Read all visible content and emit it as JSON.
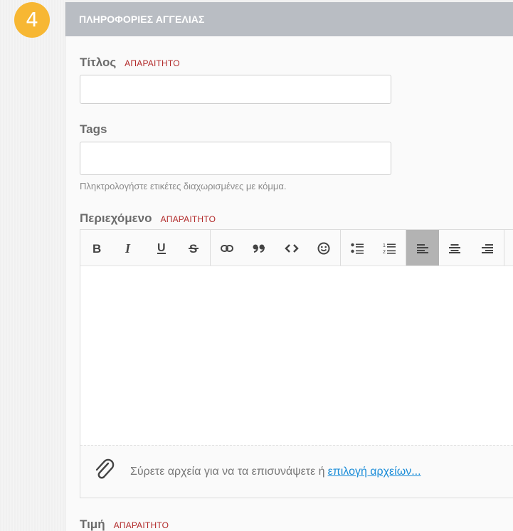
{
  "step": {
    "number": "4"
  },
  "panel": {
    "title": "ΠΛΗΡΟΦΟΡΙΕΣ ΑΓΓΕΛΙΑΣ"
  },
  "fields": {
    "title": {
      "label": "Τίτλος",
      "required": "ΑΠΑΡΑΙΤΗΤΟ",
      "value": ""
    },
    "tags": {
      "label": "Tags",
      "value": "",
      "help": "Πληκτρολογήστε ετικέτες διαχωρισμένες με κόμμα."
    },
    "content": {
      "label": "Περιεχόμενο",
      "required": "ΑΠΑΡΑΙΤΗΤΟ"
    },
    "price": {
      "label": "Τιμή",
      "required": "ΑΠΑΡΑΙΤΗΤΟ"
    }
  },
  "editor": {
    "toolbar": [
      "bold-icon",
      "italic-icon",
      "underline-icon",
      "strikethrough-icon",
      "link-icon",
      "quote-icon",
      "code-icon",
      "emoji-icon",
      "bullet-list-icon",
      "numbered-list-icon",
      "align-left-icon",
      "align-center-icon",
      "align-right-icon"
    ],
    "active_tool": "align-left-icon",
    "dropzone": {
      "text": "Σύρετε αρχεία για να τα επισυνάψετε ή",
      "link": "επιλογή αρχείων..."
    }
  },
  "colors": {
    "badge": "#f7b733",
    "header": "#b9bdc3",
    "required": "#b22a2a",
    "link": "#1a8cd8"
  }
}
